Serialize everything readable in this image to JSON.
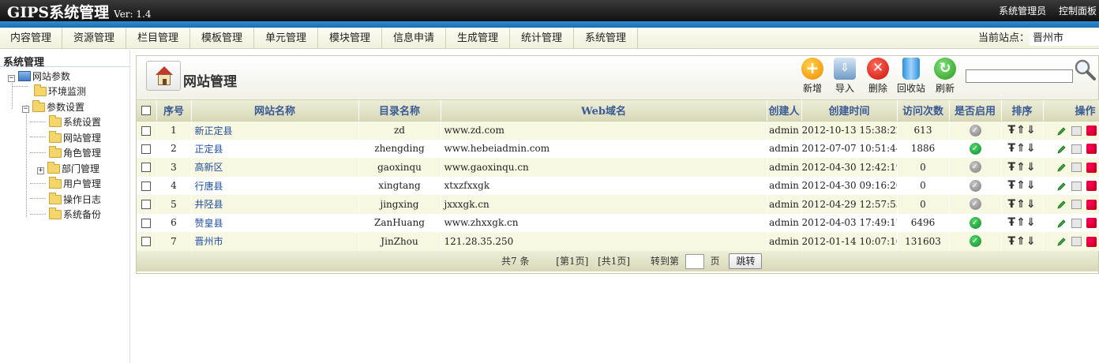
{
  "header": {
    "brand": "GIPS系统管理",
    "version": "Ver: 1.4",
    "user": "系统管理员",
    "control_panel": "控制面板"
  },
  "menu": {
    "items": [
      "内容管理",
      "资源管理",
      "栏目管理",
      "模板管理",
      "单元管理",
      "模块管理",
      "信息申请",
      "生成管理",
      "统计管理",
      "系统管理"
    ],
    "current_site_label": "当前站点：",
    "current_site": "晋州市"
  },
  "sidebar": {
    "title": "系统管理",
    "root": "网站参数",
    "monitor": "环境监测",
    "params": "参数设置",
    "children": [
      "系统设置",
      "网站管理",
      "角色管理",
      "部门管理",
      "用户管理",
      "操作日志",
      "系统备份"
    ]
  },
  "panel": {
    "title": "网站管理",
    "tools": {
      "add": "新增",
      "import": "导入",
      "delete": "删除",
      "recycle": "回收站",
      "refresh": "刷新"
    },
    "search_value": ""
  },
  "table": {
    "headers": {
      "no": "序号",
      "name": "网站名称",
      "dir": "目录名称",
      "domain": "Web域名",
      "creator": "创建人",
      "created": "创建时间",
      "visits": "访问次数",
      "enabled": "是否启用",
      "sort": "排序",
      "ops": "操作"
    },
    "rows": [
      {
        "no": "1",
        "name": "新正定县",
        "dir": "zd",
        "domain": "www.zd.com",
        "creator": "admin",
        "created": "2012-10-13 15:38:22",
        "visits": "613",
        "enabled": false
      },
      {
        "no": "2",
        "name": "正定县",
        "dir": "zhengding",
        "domain": "www.hebeiadmin.com",
        "creator": "admin",
        "created": "2012-07-07 10:51:44",
        "visits": "1886",
        "enabled": true
      },
      {
        "no": "3",
        "name": "高新区",
        "dir": "gaoxinqu",
        "domain": "www.gaoxinqu.cn",
        "creator": "admin",
        "created": "2012-04-30 12:42:19",
        "visits": "0",
        "enabled": false
      },
      {
        "no": "4",
        "name": "行唐县",
        "dir": "xingtang",
        "domain": "xtxzfxxgk",
        "creator": "admin",
        "created": "2012-04-30 09:16:20",
        "visits": "0",
        "enabled": false
      },
      {
        "no": "5",
        "name": "井陉县",
        "dir": "jingxing",
        "domain": "jxxxgk.cn",
        "creator": "admin",
        "created": "2012-04-29 12:57:53",
        "visits": "0",
        "enabled": false
      },
      {
        "no": "6",
        "name": "赞皇县",
        "dir": "ZanHuang",
        "domain": "www.zhxxgk.cn",
        "creator": "admin",
        "created": "2012-04-03 17:49:17",
        "visits": "6496",
        "enabled": true
      },
      {
        "no": "7",
        "name": "晋州市",
        "dir": "JinZhou",
        "domain": "121.28.35.250",
        "creator": "admin",
        "created": "2012-01-14 10:07:10",
        "visits": "131603",
        "enabled": true
      }
    ],
    "sort_icons": [
      "Ŧ",
      "⇑",
      "⇓"
    ]
  },
  "pager": {
    "total": "共7 条",
    "current": "[第1页]",
    "pages": "[共1页]",
    "goto": "转到第",
    "page_unit": "页",
    "jump": "跳转"
  }
}
